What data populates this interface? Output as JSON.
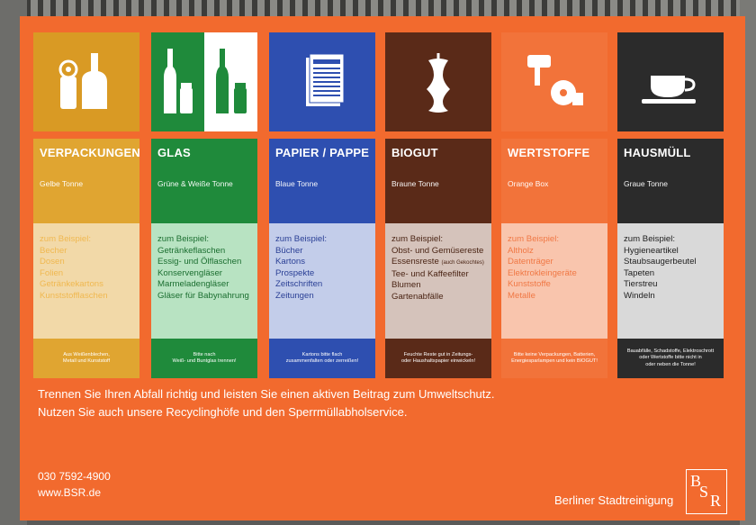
{
  "columns": [
    {
      "title": "VERPACKUNGEN",
      "subtitle": "Gelbe Tonne",
      "items": [
        "zum Beispiel:",
        "Becher",
        "Dosen",
        "Folien",
        "Getränkekartons",
        "Kunststofflaschen"
      ],
      "note": [
        "Aus Weißenblechen,",
        "Metall und Kunststoff"
      ],
      "icon": "packaging-icon",
      "colors": {
        "tile": "#d99a24",
        "head": "#e0a531",
        "list_bg": "#f2d9a8",
        "list_text": "#f0c060",
        "note": "#e0a531"
      }
    },
    {
      "title": "GLAS",
      "subtitle": "Grüne & Weiße Tonne",
      "items": [
        "zum Beispiel:",
        "Getränkeflaschen",
        "Essig- und Ölflaschen",
        "Konservengläser",
        "Marmeladengläser",
        "Gläser für Babynahrung"
      ],
      "note": [
        "Bitte nach",
        "Weiß- und Buntglas trennen!"
      ],
      "icon": "glass-bottles-icon",
      "colors": {
        "tile": "#1f8a3b",
        "head": "#1f8a3b",
        "list_bg": "#b8e3c2",
        "list_text": "#1b6e30",
        "note": "#1f8a3b"
      }
    },
    {
      "title": "PAPIER / PAPPE",
      "subtitle": "Blaue Tonne",
      "items": [
        "zum Beispiel:",
        "Bücher",
        "Kartons",
        "Prospekte",
        "Zeitschriften",
        "Zeitungen"
      ],
      "note": [
        "Kartons bitte flach",
        "zusammenfalten oder zerreißen!"
      ],
      "icon": "newspaper-icon",
      "colors": {
        "tile": "#2e4fb0",
        "head": "#2e4fb0",
        "list_bg": "#c3cdea",
        "list_text": "#2a3f95",
        "note": "#2e4fb0"
      }
    },
    {
      "title": "BIOGUT",
      "subtitle": "Braune Tonne",
      "items": [
        "zum Beispiel:",
        "Obst- und Gemüsereste",
        "Essensreste",
        "Tee- und Kaffeefilter",
        "Blumen",
        "Gartenabfälle"
      ],
      "items_extra": "(auch Gekochtes)",
      "note": [
        "Feuchte Reste gut in Zeitungs-",
        "oder Haushaltspapier einwickeln!"
      ],
      "icon": "apple-core-icon",
      "colors": {
        "tile": "#5a2a18",
        "head": "#5a2a18",
        "list_bg": "#d5c3bb",
        "list_text": "#4a2414",
        "note": "#5a2a18"
      }
    },
    {
      "title": "WERTSTOFFE",
      "subtitle": "Orange Box",
      "items": [
        "zum Beispiel:",
        "Altholz",
        "Datenträger",
        "Elektrokleingeräte",
        "Kunststoffe",
        "Metalle"
      ],
      "note": [
        "Bitte keine Verpackungen, Batterien,",
        "Energiesparlampen und kein BIOGUT!"
      ],
      "icon": "appliances-icon",
      "colors": {
        "tile": "#f2733a",
        "head": "#f2733a",
        "list_bg": "#f9c5ad",
        "list_text": "#f08050",
        "note": "#f2733a"
      }
    },
    {
      "title": "HAUSMÜLL",
      "subtitle": "Graue Tonne",
      "items": [
        "zum Beispiel:",
        "Hygieneartikel",
        "Staubsaugerbeutel",
        "Tapeten",
        "Tierstreu",
        "Windeln"
      ],
      "note": [
        "Bauabfälle, Schadstoffe, Elektroschrott",
        "oder Wertstoffe bitte nicht in",
        "oder neben die Tonne!"
      ],
      "icon": "coffee-cup-icon",
      "colors": {
        "tile": "#2b2b2b",
        "head": "#2b2b2b",
        "list_bg": "#d9d9d9",
        "list_text": "#1e1e1e",
        "note": "#2b2b2b"
      }
    }
  ],
  "tagline": [
    "Trennen Sie Ihren Abfall richtig und leisten Sie einen aktiven Beitrag zum Umweltschutz.",
    "Nutzen Sie auch unsere Recyclinghöfe und den Sperrmüllabholservice."
  ],
  "contact": {
    "phone": "030 7592-4900",
    "web": "www.BSR.de"
  },
  "brand": "Berliner Stadtreinigung",
  "logo": {
    "b": "B",
    "s": "S",
    "r": "R"
  },
  "board_color": "#f26a2e"
}
